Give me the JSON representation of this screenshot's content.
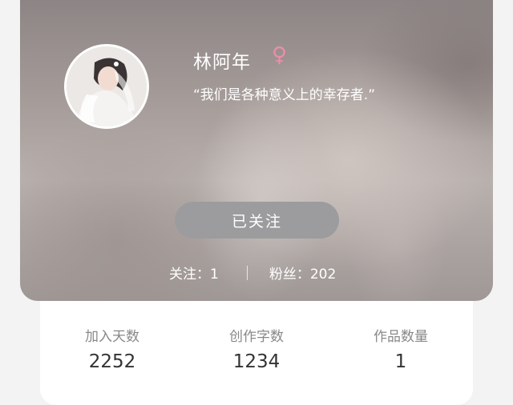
{
  "profile": {
    "name": "林阿年",
    "gender_symbol": "♀",
    "gender_color": "#ec8ea8",
    "bio": "“我们是各种意义上的幸存者.”",
    "follow_button_label": "已关注",
    "following_label": "关注：1",
    "followers_label": "粉丝：202"
  },
  "metrics": [
    {
      "label": "加入天数",
      "value": "2252"
    },
    {
      "label": "创作字数",
      "value": "1234"
    },
    {
      "label": "作品数量",
      "value": "1"
    }
  ]
}
